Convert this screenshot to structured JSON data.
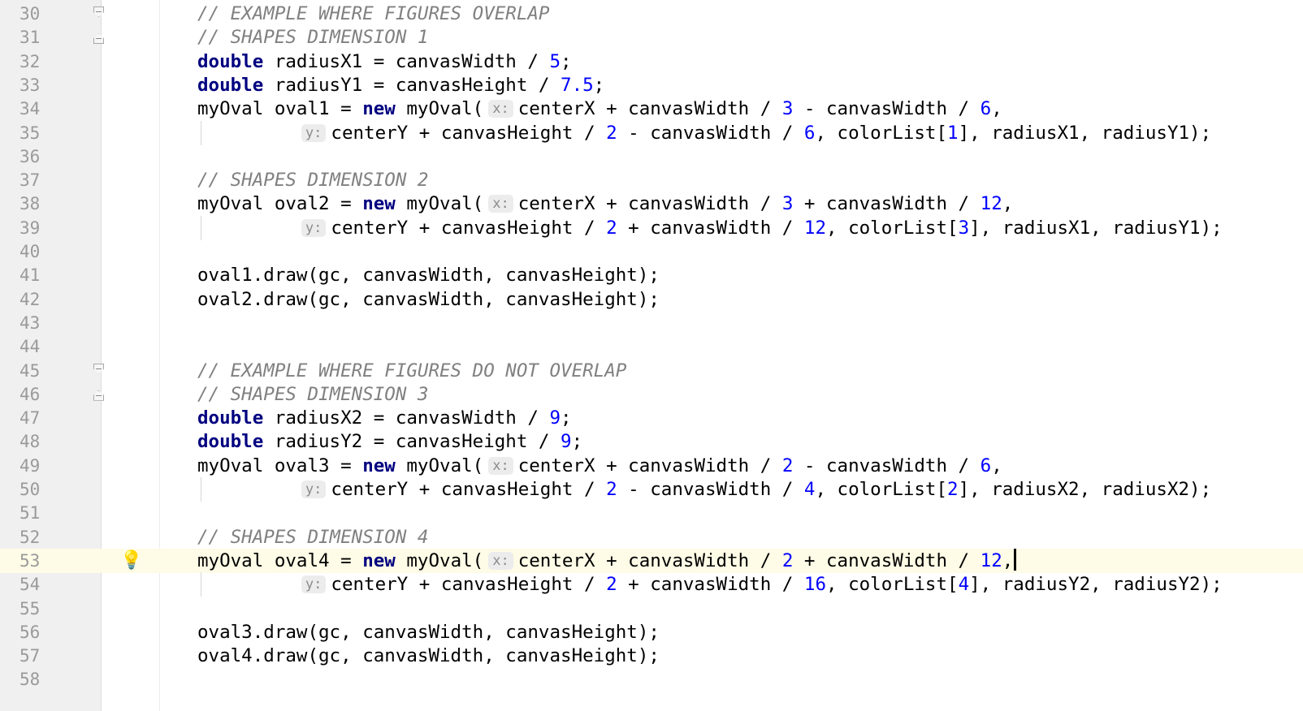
{
  "editor": {
    "lines": [
      {
        "num": "30",
        "fold": "start",
        "indent": "",
        "segments": [
          {
            "t": "c",
            "v": "// EXAMPLE WHERE FIGURES OVERLAP"
          }
        ]
      },
      {
        "num": "31",
        "fold": "end",
        "indent": "",
        "segments": [
          {
            "t": "c",
            "v": "// SHAPES DIMENSION 1"
          }
        ]
      },
      {
        "num": "32",
        "indent": "",
        "segments": [
          {
            "t": "k",
            "v": "double"
          },
          {
            "t": "p",
            "v": " radiusX1 = canvasWidth / "
          },
          {
            "t": "n",
            "v": "5"
          },
          {
            "t": "p",
            "v": ";"
          }
        ]
      },
      {
        "num": "33",
        "indent": "",
        "segments": [
          {
            "t": "k",
            "v": "double"
          },
          {
            "t": "p",
            "v": " radiusY1 = canvasHeight / "
          },
          {
            "t": "n",
            "v": "7.5"
          },
          {
            "t": "p",
            "v": ";"
          }
        ]
      },
      {
        "num": "34",
        "indent": "",
        "segments": [
          {
            "t": "p",
            "v": "myOval oval1 = "
          },
          {
            "t": "k",
            "v": "new"
          },
          {
            "t": "p",
            "v": " myOval("
          },
          {
            "t": "h",
            "v": "x:"
          },
          {
            "t": "p",
            "v": "centerX + canvasWidth / "
          },
          {
            "t": "n",
            "v": "3"
          },
          {
            "t": "p",
            "v": " - canvasWidth / "
          },
          {
            "t": "n",
            "v": "6"
          },
          {
            "t": "p",
            "v": ","
          }
        ]
      },
      {
        "num": "35",
        "guide": true,
        "indent": "         ",
        "segments": [
          {
            "t": "h",
            "v": "y:"
          },
          {
            "t": "p",
            "v": "centerY + canvasHeight / "
          },
          {
            "t": "n",
            "v": "2"
          },
          {
            "t": "p",
            "v": " - canvasWidth / "
          },
          {
            "t": "n",
            "v": "6"
          },
          {
            "t": "p",
            "v": ", colorList["
          },
          {
            "t": "n",
            "v": "1"
          },
          {
            "t": "p",
            "v": "], radiusX1, radiusY1);"
          }
        ]
      },
      {
        "num": "36",
        "indent": "",
        "segments": []
      },
      {
        "num": "37",
        "indent": "",
        "segments": [
          {
            "t": "c",
            "v": "// SHAPES DIMENSION 2"
          }
        ]
      },
      {
        "num": "38",
        "indent": "",
        "segments": [
          {
            "t": "p",
            "v": "myOval oval2 = "
          },
          {
            "t": "k",
            "v": "new"
          },
          {
            "t": "p",
            "v": " myOval("
          },
          {
            "t": "h",
            "v": "x:"
          },
          {
            "t": "p",
            "v": "centerX + canvasWidth / "
          },
          {
            "t": "n",
            "v": "3"
          },
          {
            "t": "p",
            "v": " + canvasWidth / "
          },
          {
            "t": "n",
            "v": "12"
          },
          {
            "t": "p",
            "v": ","
          }
        ]
      },
      {
        "num": "39",
        "guide": true,
        "indent": "         ",
        "segments": [
          {
            "t": "h",
            "v": "y:"
          },
          {
            "t": "p",
            "v": "centerY + canvasHeight / "
          },
          {
            "t": "n",
            "v": "2"
          },
          {
            "t": "p",
            "v": " + canvasWidth / "
          },
          {
            "t": "n",
            "v": "12"
          },
          {
            "t": "p",
            "v": ", colorList["
          },
          {
            "t": "n",
            "v": "3"
          },
          {
            "t": "p",
            "v": "], radiusX1, radiusY1);"
          }
        ]
      },
      {
        "num": "40",
        "indent": "",
        "segments": []
      },
      {
        "num": "41",
        "indent": "",
        "segments": [
          {
            "t": "p",
            "v": "oval1.draw(gc, canvasWidth, canvasHeight);"
          }
        ]
      },
      {
        "num": "42",
        "indent": "",
        "segments": [
          {
            "t": "p",
            "v": "oval2.draw(gc, canvasWidth, canvasHeight);"
          }
        ]
      },
      {
        "num": "43",
        "indent": "",
        "segments": []
      },
      {
        "num": "44",
        "indent": "",
        "segments": []
      },
      {
        "num": "45",
        "fold": "start",
        "indent": "",
        "segments": [
          {
            "t": "c",
            "v": "// EXAMPLE WHERE FIGURES DO NOT OVERLAP"
          }
        ]
      },
      {
        "num": "46",
        "fold": "end",
        "indent": "",
        "segments": [
          {
            "t": "c",
            "v": "// SHAPES DIMENSION 3"
          }
        ]
      },
      {
        "num": "47",
        "indent": "",
        "segments": [
          {
            "t": "k",
            "v": "double"
          },
          {
            "t": "p",
            "v": " radiusX2 = canvasWidth / "
          },
          {
            "t": "n",
            "v": "9"
          },
          {
            "t": "p",
            "v": ";"
          }
        ]
      },
      {
        "num": "48",
        "indent": "",
        "segments": [
          {
            "t": "k",
            "v": "double"
          },
          {
            "t": "p",
            "v": " radiusY2 = canvasHeight / "
          },
          {
            "t": "n",
            "v": "9"
          },
          {
            "t": "p",
            "v": ";"
          }
        ]
      },
      {
        "num": "49",
        "indent": "",
        "segments": [
          {
            "t": "p",
            "v": "myOval oval3 = "
          },
          {
            "t": "k",
            "v": "new"
          },
          {
            "t": "p",
            "v": " myOval("
          },
          {
            "t": "h",
            "v": "x:"
          },
          {
            "t": "p",
            "v": "centerX + canvasWidth / "
          },
          {
            "t": "n",
            "v": "2"
          },
          {
            "t": "p",
            "v": " - canvasWidth / "
          },
          {
            "t": "n",
            "v": "6"
          },
          {
            "t": "p",
            "v": ","
          }
        ]
      },
      {
        "num": "50",
        "guide": true,
        "indent": "         ",
        "segments": [
          {
            "t": "h",
            "v": "y:"
          },
          {
            "t": "p",
            "v": "centerY + canvasHeight / "
          },
          {
            "t": "n",
            "v": "2"
          },
          {
            "t": "p",
            "v": " - canvasWidth / "
          },
          {
            "t": "n",
            "v": "4"
          },
          {
            "t": "p",
            "v": ", colorList["
          },
          {
            "t": "n",
            "v": "2"
          },
          {
            "t": "p",
            "v": "], radiusX2, radiusX2);"
          }
        ]
      },
      {
        "num": "51",
        "indent": "",
        "segments": []
      },
      {
        "num": "52",
        "indent": "",
        "segments": [
          {
            "t": "c",
            "v": "// SHAPES DIMENSION 4"
          }
        ]
      },
      {
        "num": "53",
        "current": true,
        "bulb": true,
        "caret": true,
        "indent": "",
        "segments": [
          {
            "t": "p",
            "v": "myOval oval4 = "
          },
          {
            "t": "k",
            "v": "new"
          },
          {
            "t": "p",
            "v": " myOval("
          },
          {
            "t": "h",
            "v": "x:"
          },
          {
            "t": "p",
            "v": "centerX + canvasWidth / "
          },
          {
            "t": "n",
            "v": "2"
          },
          {
            "t": "p",
            "v": " + canvasWidth / "
          },
          {
            "t": "n",
            "v": "12"
          },
          {
            "t": "p",
            "v": ","
          }
        ]
      },
      {
        "num": "54",
        "guide": true,
        "indent": "         ",
        "segments": [
          {
            "t": "h",
            "v": "y:"
          },
          {
            "t": "p",
            "v": "centerY + canvasHeight / "
          },
          {
            "t": "n",
            "v": "2"
          },
          {
            "t": "p",
            "v": " + canvasWidth / "
          },
          {
            "t": "n",
            "v": "16"
          },
          {
            "t": "p",
            "v": ", colorList["
          },
          {
            "t": "n",
            "v": "4"
          },
          {
            "t": "p",
            "v": "], radiusY2, radiusY2);"
          }
        ]
      },
      {
        "num": "55",
        "indent": "",
        "segments": []
      },
      {
        "num": "56",
        "indent": "",
        "segments": [
          {
            "t": "p",
            "v": "oval3.draw(gc, canvasWidth, canvasHeight);"
          }
        ]
      },
      {
        "num": "57",
        "indent": "",
        "segments": [
          {
            "t": "p",
            "v": "oval4.draw(gc, canvasWidth, canvasHeight);"
          }
        ]
      },
      {
        "num": "58",
        "indent": "",
        "segments": []
      }
    ],
    "icons": {
      "bulb": "lightbulb-icon",
      "fold": "fold-marker-icon"
    },
    "colors": {
      "keyword": "#000080",
      "number": "#0000ff",
      "comment": "#808080",
      "current_line": "#fefbe6"
    }
  }
}
